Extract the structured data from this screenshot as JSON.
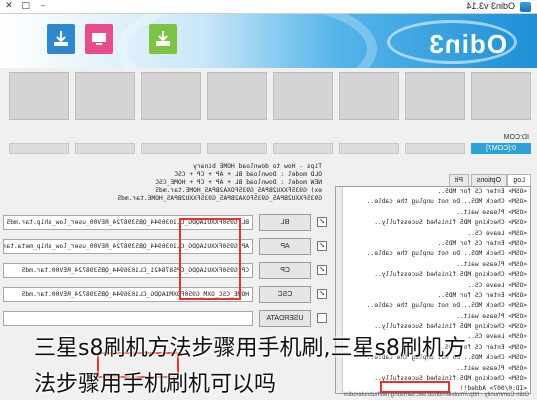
{
  "window": {
    "title": "Odin3 v3.14"
  },
  "banner": {
    "logo": "Odin3"
  },
  "idcom": {
    "label": "ID:COM",
    "port": "0:[COM7]"
  },
  "tabs": [
    "Log",
    "Options",
    "Pit"
  ],
  "log_lines": [
    "<OSM> Enter CS for MD5..",
    "<OSM> Check MD5.. Do not unplug the cable..",
    "<OSM> Please wait..",
    "<OSM> Checking MD5 finished Sucessfully..",
    "<OSM> Leave CS..",
    "<OSM> Enter CS for MD5..",
    "<OSM> Check MD5.. Do not unplug the cable..",
    "<OSM> Please wait..",
    "<OSM> Checking MD5 finished Sucessfully..",
    "<OSM> Leave CS..",
    "<OSM> Enter CS for MD5..",
    "<OSM> Check MD5.. Do not unplug the cable..",
    "<OSM> Please wait..",
    "<OSM> Checking MD5 finished Sucessfully..",
    "<OSM> Leave CS..",
    "<OSM> Enter CS for MD5..",
    "<OSM> Check MD5.. Do not unplug the cable..",
    "<OSM> Please wait..",
    "<OSM> Checking MD5 finished Sucessfully..",
    "<ID:0/007> Added!!"
  ],
  "footer_left": "Odin Community : http://mobilerndhub.sec.samsung.net/hub/site/odin/",
  "tips": [
    "Tips - How to download HOME binary",
    "OLD model : Download BL + AP + CP + CSC",
    "NEW model : Download BL + AP + CP + HOME_CSC",
    "ex) G935FXXU2BPA5_G935FOXA2BPA5_HOME.tar.md5",
    "     G935FXXU2BPA5_G935FOXA2BPA5_G935FXXU2BPA5_HOME.tar.md5"
  ],
  "file_rows": [
    {
      "button": "BL",
      "path": "BL_G950FXXU1AQDG_CL1036944_QB5398724_REV00_user_low_ship.tar.md5",
      "checked": true
    },
    {
      "button": "AP",
      "path": "AP_G950FXXU1AQDG_CL1036944_QB5398724_REV00_user_low_ship_meta.tar.md5",
      "checked": true
    },
    {
      "button": "CP",
      "path": "CP_G950FXXU1AQDG_CP5878421_CL1036944_QB5398724_REV00.tar.md5",
      "checked": true
    },
    {
      "button": "CSC",
      "path": "HOME_CSC_OXM_G950FOXM1AQDG_CL1036944_QB5398724_REV00.tar.md5",
      "checked": true
    },
    {
      "button": "USERDATA",
      "path": "",
      "checked": false
    }
  ],
  "caption": {
    "line1": "三星s8刷机方法步骤用手机刷,三星s8刷机方",
    "line2": "法步骤用手机刷机可以吗"
  },
  "colors": {
    "com_cell": "#2aa4d8",
    "highlight": "#e0362f"
  }
}
